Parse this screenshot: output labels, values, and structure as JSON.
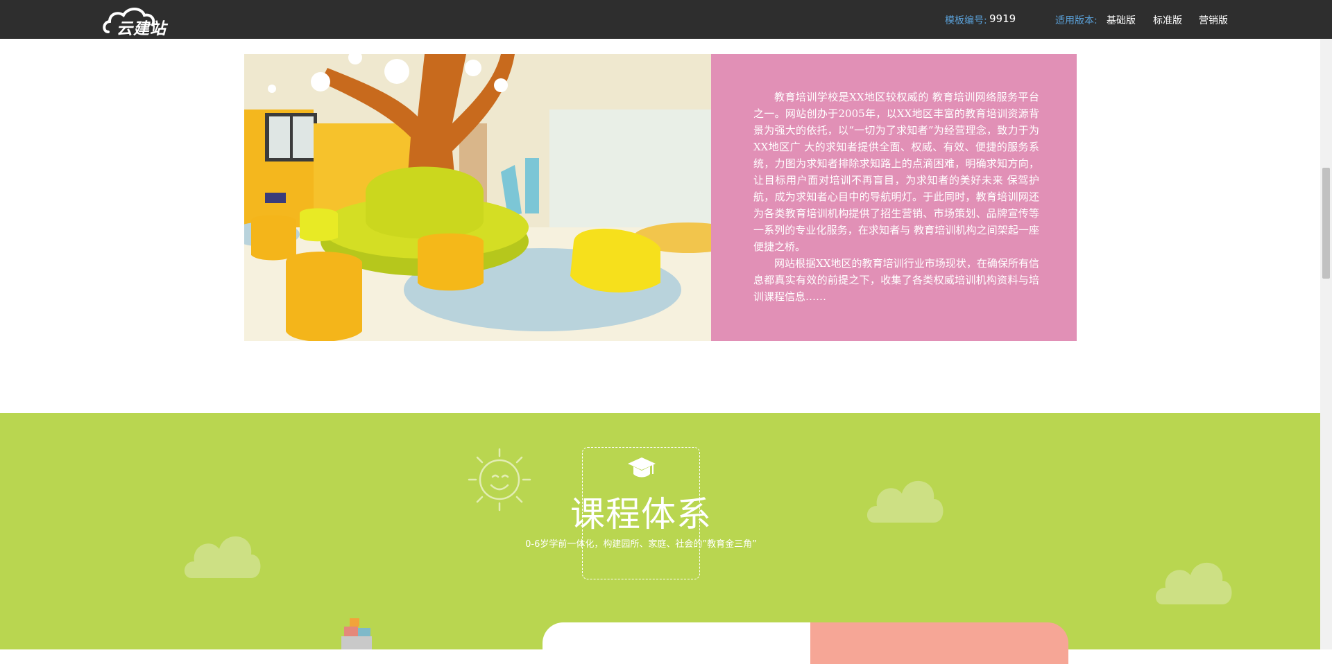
{
  "topbar": {
    "logo_text": "云建站",
    "template_label": "模板编号:",
    "template_number": "9919",
    "version_label": "适用版本:",
    "versions": [
      "基础版",
      "标准版",
      "营销版"
    ]
  },
  "intro": {
    "paragraphs": [
      "教育培训学校是XX地区较权威的 教育培训网络服务平台之一。网站创办于2005年，以XX地区丰富的教育培训资源背景为强大的依托，以“一切为了求知者”为经营理念，致力于为XX地区广 大的求知者提供全面、权威、有效、便捷的服务系统，力图为求知者排除求知路上的点滴困难，明确求知方向，让目标用户面对培训不再盲目，为求知者的美好未来 保驾护航，成为求知者心目中的导航明灯。于此同时，教育培训网还为各类教育培训机构提供了招生营销、市场策划、品牌宣传等一系列的专业化服务，在求知者与 教育培训机构之间架起一座便捷之桥。",
      "网站根据XX地区的教育培训行业市场现状，在确保所有信息都真实有效的前提之下，收集了各类权威培训机构资料与培训课程信息……"
    ],
    "box_color": "#e190b6"
  },
  "courses": {
    "title": "课程体系",
    "subtitle": "0-6岁学前一体化，构建园所、家庭、社会的”教育金三角”",
    "icon": "graduation-cap-icon",
    "section_color": "#b9d650"
  }
}
